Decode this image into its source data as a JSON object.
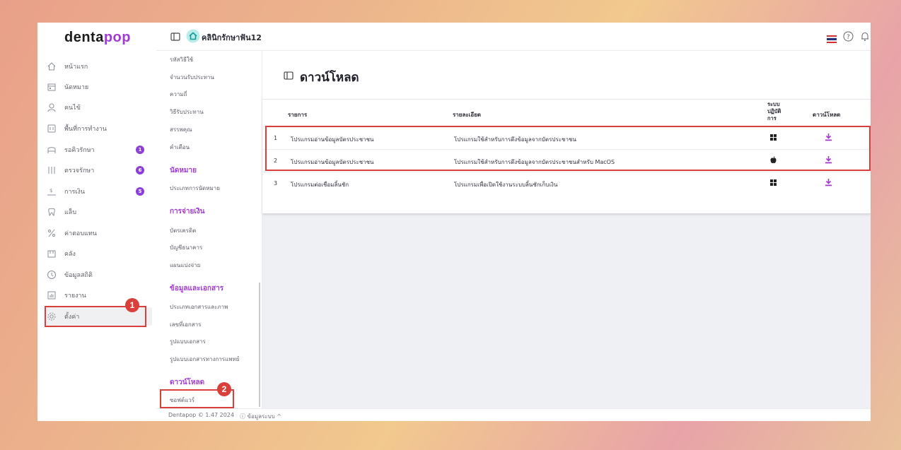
{
  "brand": {
    "logo_part1": "denta",
    "logo_part2": "pop"
  },
  "header": {
    "clinic_name": "คลินิกรักษาฟัน12"
  },
  "sidebar": {
    "items": [
      {
        "label": "หน้าแรก",
        "icon": "home-icon"
      },
      {
        "label": "นัดหมาย",
        "icon": "calendar-icon"
      },
      {
        "label": "คนไข้",
        "icon": "user-icon"
      },
      {
        "label": "พื้นที่การทำงาน",
        "icon": "workspace-icon"
      },
      {
        "label": "รอคิวรักษา",
        "icon": "chair-icon",
        "badge": "1"
      },
      {
        "label": "ตรวจรักษา",
        "icon": "tools-icon",
        "badge": "6"
      },
      {
        "label": "การเงิน",
        "icon": "money-icon",
        "badge": "5"
      },
      {
        "label": "แล็บ",
        "icon": "tooth-icon"
      },
      {
        "label": "ค่าตอบแทน",
        "icon": "percent-icon"
      },
      {
        "label": "คลัง",
        "icon": "inventory-icon"
      },
      {
        "label": "ข้อมูลสถิติ",
        "icon": "statistics-icon"
      },
      {
        "label": "รายงาน",
        "icon": "report-icon"
      },
      {
        "label": "ตั้งค่า",
        "icon": "gear-icon"
      }
    ]
  },
  "submenu": {
    "top_items": [
      "รหัสวิธีใช้",
      "จำนวนรับประทาน",
      "ความถี่",
      "วิธีรับประทาน",
      "สรรพคุณ",
      "คำเตือน"
    ],
    "appointment_header": "นัดหมาย",
    "appointment_items": [
      "ประเภทการนัดหมาย"
    ],
    "payment_header": "การจ่ายเงิน",
    "payment_items": [
      "บัตรเครดิต",
      "บัญชีธนาคาร",
      "แผนแบ่งจ่าย"
    ],
    "documents_header": "ข้อมูลและเอกสาร",
    "documents_items": [
      "ประเภทเอกสารและภาพ",
      "เลขที่เอกสาร",
      "รูปแบบเอกสาร",
      "รูปแบบเอกสารทางการแพทย์"
    ],
    "download_header": "ดาวน์โหลด",
    "download_items": [
      "ซอฟต์แวร์"
    ]
  },
  "page": {
    "title": "ดาวน์โหลด"
  },
  "table": {
    "headers": {
      "name": "รายการ",
      "detail": "รายละเอียด",
      "os_line1": "ระบบ",
      "os_line2": "ปฏิบัติ",
      "os_line3": "การ",
      "download": "ดาวน์โหลด"
    },
    "rows": [
      {
        "no": "1",
        "name": "โปรแกรมอ่านข้อมูลบัตรประชาชน",
        "detail": "โปรแกรมใช้สำหรับการดึงข้อมูลจากบัตรประชาชน",
        "os": "windows-icon"
      },
      {
        "no": "2",
        "name": "โปรแกรมอ่านข้อมูลบัตรประชาชน",
        "detail": "โปรแกรมใช้สำหรับการดึงข้อมูลจากบัตรประชาชนสำหรับ MacOS",
        "os": "apple-icon"
      },
      {
        "no": "3",
        "name": "โปรแกรมต่อเชื่อมลิ้นชัก",
        "detail": "โปรแกรมเพื่อเปิดใช้งานระบบลิ้นชักเก็บเงิน",
        "os": "windows-icon"
      }
    ]
  },
  "annotations": {
    "step1": "1",
    "step2": "2"
  },
  "footer": {
    "version": "Dentapop © 1.47 2024",
    "system_info": "ⓘ ข้อมูลระบบ ^"
  },
  "colors": {
    "accent": "#a43ad6",
    "highlight": "#d93f3b",
    "badge": "#8b3fd8",
    "download_icon": "#a43ad6"
  }
}
